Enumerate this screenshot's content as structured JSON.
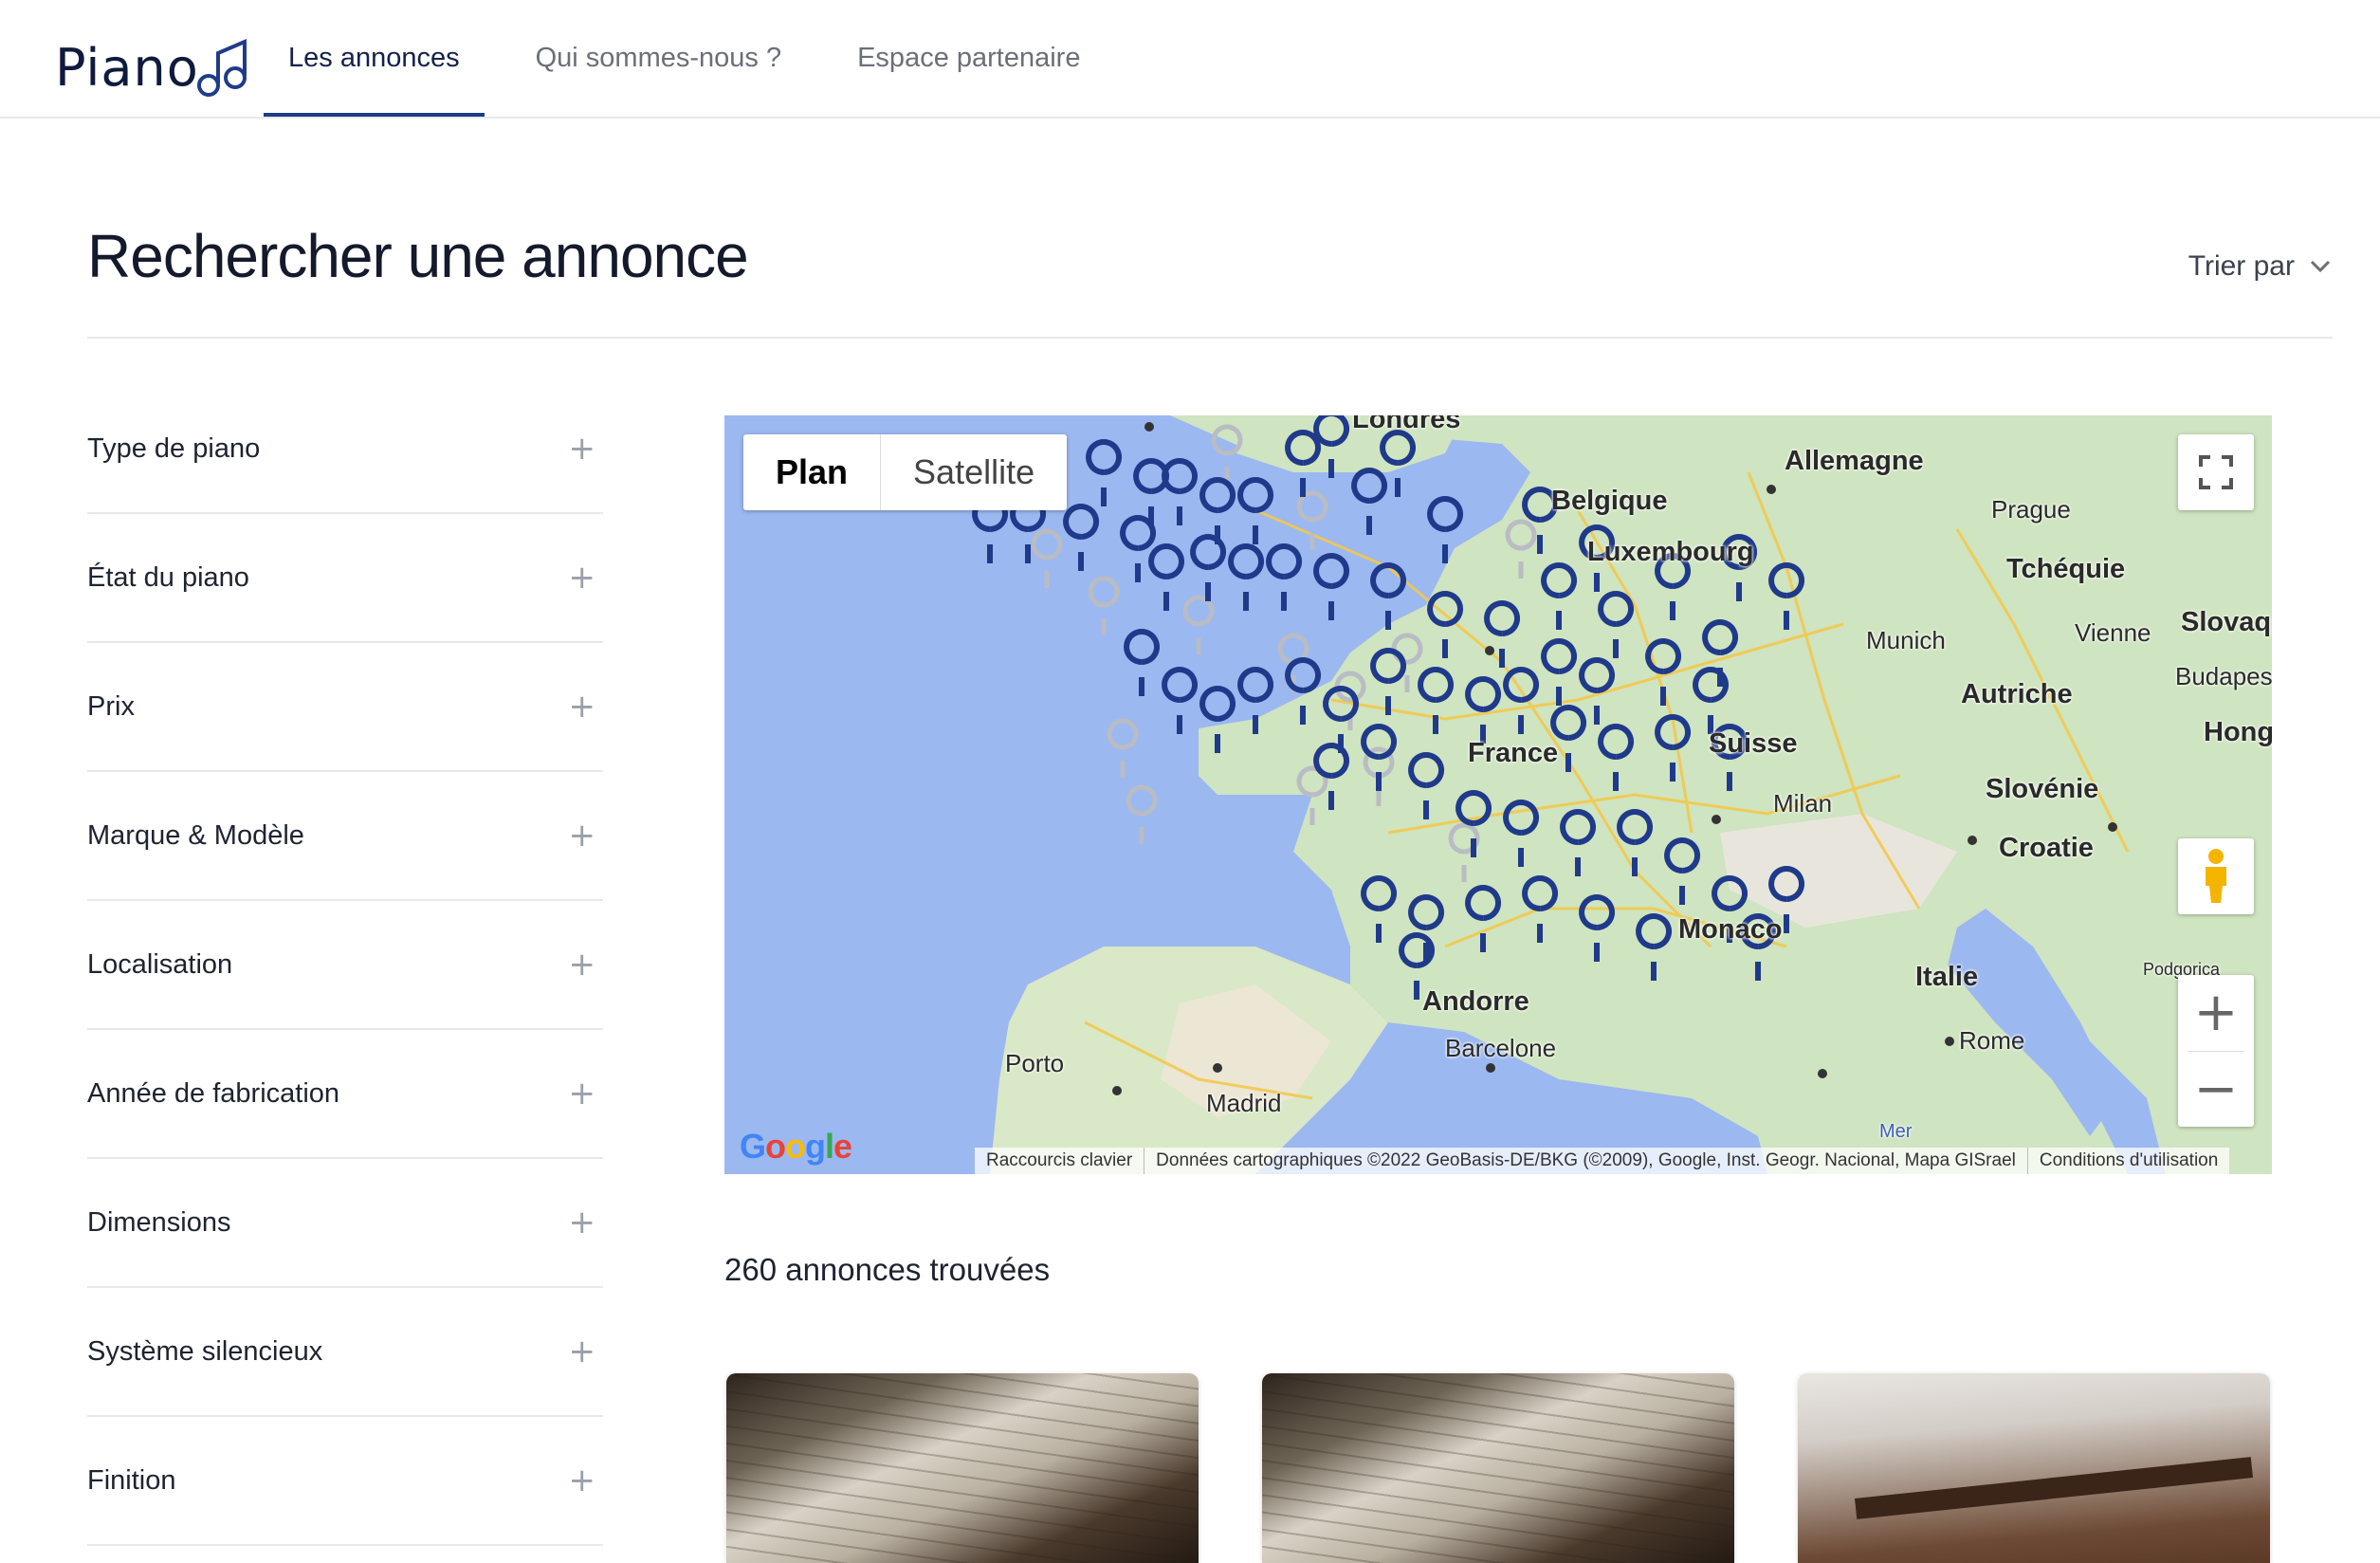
{
  "header": {
    "logo_text": "Piano",
    "nav": [
      {
        "label": "Les annonces",
        "active": true
      },
      {
        "label": "Qui sommes-nous ?",
        "active": false
      },
      {
        "label": "Espace partenaire",
        "active": false
      }
    ]
  },
  "page": {
    "title": "Rechercher une annonce",
    "sort_label": "Trier par"
  },
  "filters": [
    {
      "label": "Type de piano"
    },
    {
      "label": "État du piano"
    },
    {
      "label": "Prix"
    },
    {
      "label": "Marque & Modèle"
    },
    {
      "label": "Localisation"
    },
    {
      "label": "Année de fabrication"
    },
    {
      "label": "Dimensions"
    },
    {
      "label": "Système silencieux"
    },
    {
      "label": "Finition"
    }
  ],
  "map": {
    "type_plan": "Plan",
    "type_satellite": "Satellite",
    "zoom_in": "+",
    "zoom_out": "−",
    "labels": {
      "londres": "Londres",
      "belgique": "Belgique",
      "allemagne": "Allemagne",
      "prague": "Prague",
      "luxembourg": "Luxembourg",
      "tcheque": "Tchéquie",
      "munich": "Munich",
      "vienne": "Vienne",
      "slovaq": "Slovaq",
      "budapest": "Budapes",
      "autriche": "Autriche",
      "hong": "Hong",
      "france": "France",
      "suisse": "Suisse",
      "slovenie": "Slovénie",
      "milan": "Milan",
      "croatie": "Croatie",
      "monaco": "Monaco",
      "italie": "Italie",
      "andorre": "Andorre",
      "barcelone": "Barcelone",
      "rome": "Rome",
      "porto": "Porto",
      "madrid": "Madrid",
      "mer": "Mer",
      "podgorica": "Podgorica"
    },
    "google": "Google",
    "attribution": {
      "shortcuts": "Raccourcis clavier",
      "data": "Données cartographiques ©2022 GeoBasis-DE/BKG (©2009), Google, Inst. Geogr. Nacional, Mapa GISrael",
      "terms": "Conditions d'utilisation"
    },
    "colors": {
      "water": "#9bb8f0",
      "land": "#cfe4c0",
      "pin": "#1f3a8a",
      "pin_light": "#b9bcc4"
    }
  },
  "results": {
    "count_text": "260 annonces trouvées"
  }
}
